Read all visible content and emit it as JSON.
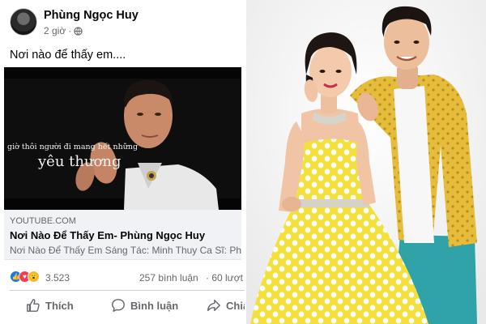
{
  "post": {
    "author": "Phùng Ngọc Huy",
    "time": "2 giờ",
    "separator": "·",
    "text": "Nơi nào để thấy em....",
    "video": {
      "subtitle_small": "giờ thôi người đi mang hết những",
      "subtitle_big": "yêu thương"
    },
    "link": {
      "domain": "YOUTUBE.COM",
      "title": "Nơi Nào Để Thấy Em- Phùng Ngọc Huy",
      "description": "Nơi Nào Để Thấy Em Sáng Tác: Minh Thuy Ca Sĩ: Ph"
    },
    "stats": {
      "reactions": "3.523",
      "comments": "257 bình luận",
      "shares": "· 60 lượt c"
    },
    "actions": {
      "like": "Thích",
      "comment": "Bình luận",
      "share": "Chia"
    },
    "icons": {
      "globe": "globe-icon",
      "like": "thumbs-up-icon",
      "comment": "comment-bubble-icon",
      "share": "share-arrow-icon"
    }
  },
  "colors": {
    "secondary_text": "#65676b",
    "like_blue": "#1877f2",
    "love_red": "#f33e58",
    "dress_yellow": "#f5e23a",
    "jacket_yellow": "#e9c23a",
    "pants_teal": "#2fa3a8"
  }
}
